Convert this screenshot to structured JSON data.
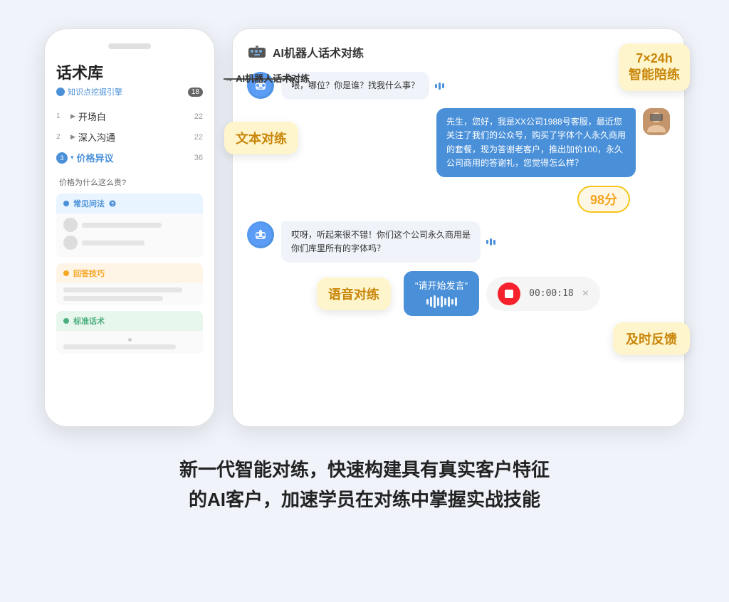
{
  "phone": {
    "title": "话术库",
    "subtitle": "知识点挖掘引擎",
    "badge_count": "18",
    "menu_items": [
      {
        "num": "1",
        "arrow": "▶",
        "label": "开场白",
        "count": "22",
        "active": false
      },
      {
        "num": "2",
        "arrow": "▶",
        "label": "深入沟通",
        "count": "22",
        "active": false
      },
      {
        "num": "3",
        "arrow": "▾",
        "label": "价格异议",
        "count": "36",
        "active": true
      }
    ],
    "sub_question": "价格为什么这么贵?",
    "section_faq": "常见问法",
    "section_tips": "回答技巧",
    "section_standard": "标准话术"
  },
  "panel": {
    "title": "AI机器人话术对练",
    "badge_247": "7×24h\n智能陪练",
    "badge_score": "98分",
    "badge_feedback": "及时反馈",
    "badge_text": "文本对练",
    "badge_voice": "语音对练",
    "messages": [
      {
        "type": "bot",
        "text": "喂，哪位？你是谁？找我什么事？",
        "has_sound": true
      },
      {
        "type": "user",
        "text": "先生，您好，我是XX公司1988号客服，最近您关注了我们的公众号，购买了字体个人永久商用的套餐，现为答谢老客户，推出加价100，永久公司商用的答谢礼，您觉得怎么样？"
      },
      {
        "type": "bot",
        "text": "哎呀，听起来很不错！你们这个公司永久商用是你们库里所有的字体吗？",
        "has_sound": true
      }
    ],
    "voice_prompt": "\"请开始发言\"",
    "timer": "00:00:18",
    "timer_label": "×"
  },
  "tagline": {
    "line1": "新一代智能对练，快速构建具有真实客户特征",
    "line2": "的AI客户，加速学员在对练中掌握实战技能"
  }
}
